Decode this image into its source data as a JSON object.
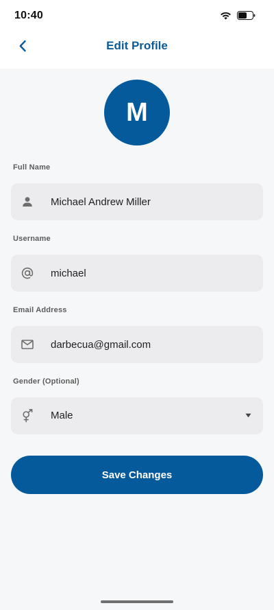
{
  "status_bar": {
    "time": "10:40",
    "wifi_icon": "wifi-icon",
    "battery_icon": "battery-icon",
    "battery_level": 0.6
  },
  "header": {
    "back_icon": "chevron-left-icon",
    "title": "Edit Profile"
  },
  "avatar": {
    "initial": "M"
  },
  "form": {
    "full_name": {
      "label": "Full Name",
      "value": "Michael Andrew Miller",
      "icon": "person-icon"
    },
    "username": {
      "label": "Username",
      "value": "michael",
      "icon": "at-icon"
    },
    "email": {
      "label": "Email Address",
      "value": "darbecua@gmail.com",
      "icon": "mail-icon"
    },
    "gender": {
      "label": "Gender (Optional)",
      "selected": "Male",
      "icon": "gender-icon",
      "caret_icon": "caret-down-icon"
    }
  },
  "actions": {
    "save_label": "Save Changes"
  },
  "colors": {
    "primary": "#055a9c",
    "title": "#0b5b99",
    "field_bg": "#ececee",
    "page_bg": "#f6f7f9"
  }
}
